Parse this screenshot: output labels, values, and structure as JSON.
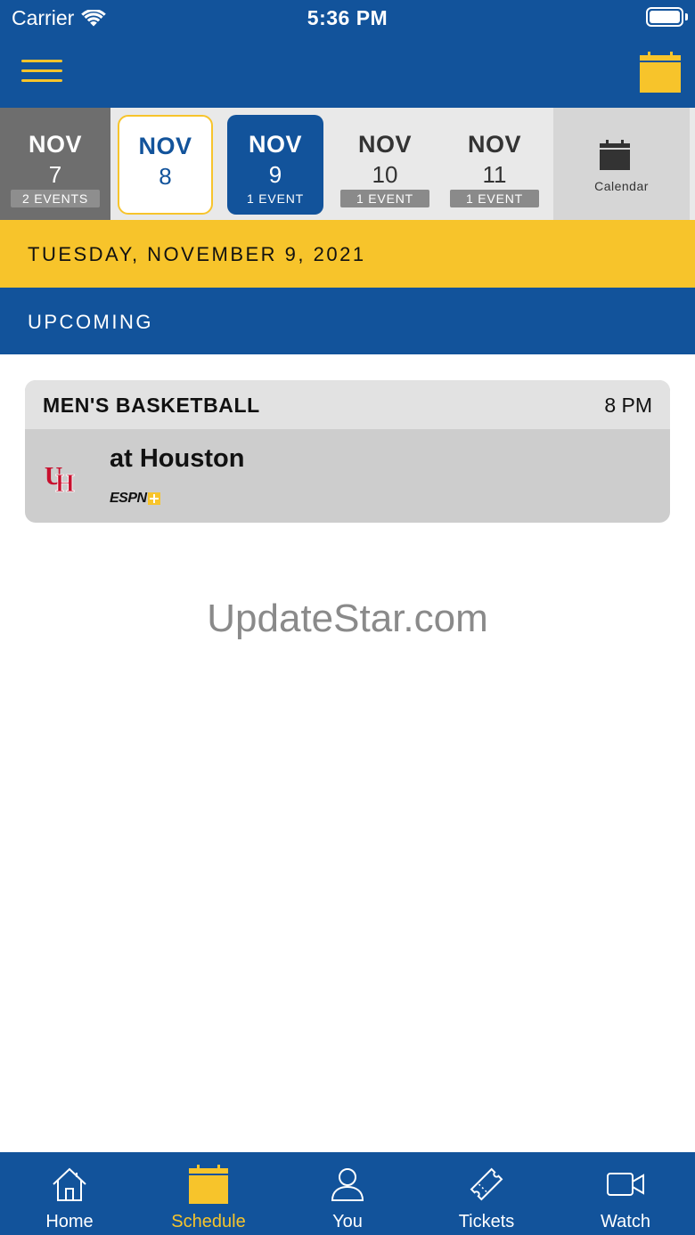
{
  "status_bar": {
    "carrier": "Carrier",
    "time": "5:36 PM",
    "icons": [
      "wifi-icon",
      "battery-icon"
    ]
  },
  "nav": {
    "menu_icon": "hamburger-menu-icon",
    "calendar_icon": "calendar-icon"
  },
  "date_strip": {
    "days": [
      {
        "month": "NOV",
        "day": "7",
        "events": "2 EVENTS",
        "state": "past"
      },
      {
        "month": "NOV",
        "day": "8",
        "events": "",
        "state": "today"
      },
      {
        "month": "NOV",
        "day": "9",
        "events": "1 EVENT",
        "state": "selected"
      },
      {
        "month": "NOV",
        "day": "10",
        "events": "1 EVENT",
        "state": "upcoming"
      },
      {
        "month": "NOV",
        "day": "11",
        "events": "1 EVENT",
        "state": "upcoming"
      }
    ],
    "calendar_label": "Calendar"
  },
  "selected_date": "TUESDAY, NOVEMBER 9, 2021",
  "section_title": "UPCOMING",
  "events": [
    {
      "sport": "MEN'S BASKETBALL",
      "time": "8 PM",
      "opponent": "at Houston",
      "opponent_logo": "UH",
      "network": "ESPN"
    }
  ],
  "watermark": "UpdateStar.com",
  "tabs": [
    {
      "label": "Home",
      "icon": "home-icon",
      "active": false
    },
    {
      "label": "Schedule",
      "icon": "calendar-icon",
      "active": true
    },
    {
      "label": "You",
      "icon": "person-icon",
      "active": false
    },
    {
      "label": "Tickets",
      "icon": "ticket-icon",
      "active": false
    },
    {
      "label": "Watch",
      "icon": "video-camera-icon",
      "active": false
    }
  ],
  "colors": {
    "primary_blue": "#12539b",
    "accent_yellow": "#f7c42b",
    "opponent_red": "#c8102e"
  }
}
